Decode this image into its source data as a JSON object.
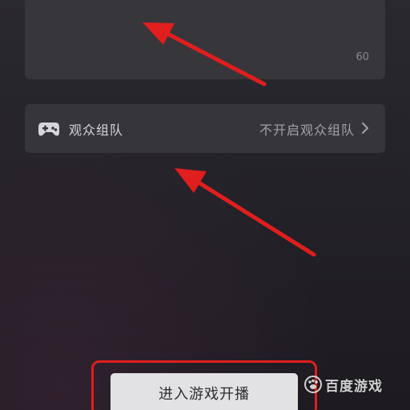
{
  "text_card": {
    "char_count": "60"
  },
  "audience_team": {
    "icon": "gamepad-icon",
    "label": "观众组队",
    "value": "不开启观众组队",
    "chevron": "chevron-right-icon"
  },
  "start_button": {
    "label": "进入游戏开播"
  },
  "watermark": {
    "text": "百度游戏"
  },
  "colors": {
    "annotation_red": "#e01e1e",
    "card": "#37363b",
    "button": "#e2e1e3"
  }
}
